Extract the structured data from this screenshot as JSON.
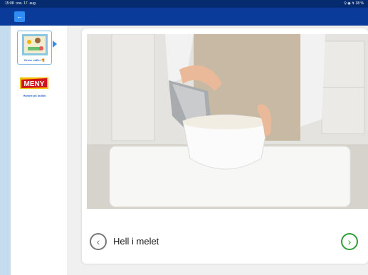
{
  "status": {
    "time": "15:08",
    "date": "ons. 17. aug.",
    "indicators": "⚲ ◉ ↯ 38 %"
  },
  "appbar": {
    "back_glyph": "←"
  },
  "sidebar": {
    "items": [
      {
        "label": "Grove vafler 🥞",
        "icon": "waffle-recipe-icon"
      },
      {
        "label": "Handle på butikk",
        "logo_text": "MENY",
        "icon": "meny-logo-icon"
      }
    ]
  },
  "step": {
    "caption": "Hell i melet",
    "prev_glyph": "‹",
    "next_glyph": "›"
  },
  "colors": {
    "statusbar": "#062b6e",
    "appbar": "#0b3b9a",
    "accent": "#2f8df5",
    "next": "#2e9d37"
  }
}
